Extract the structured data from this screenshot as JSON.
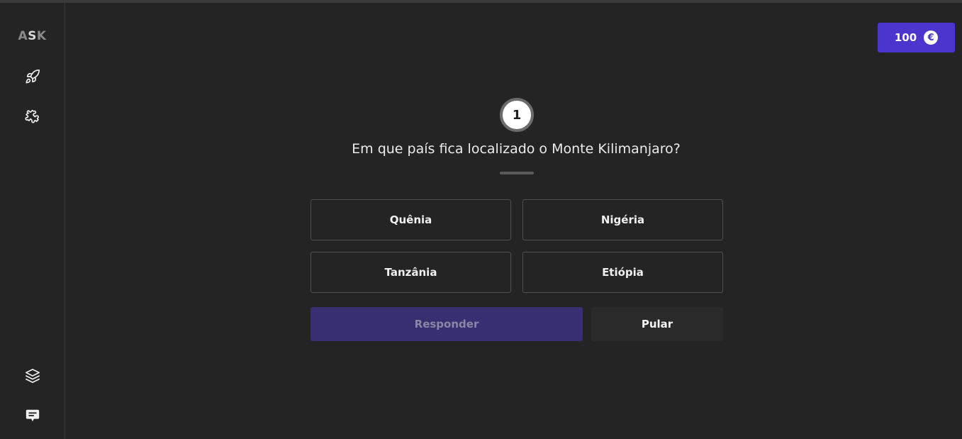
{
  "sidebar": {
    "logo": {
      "part1": "A",
      "part2": "S",
      "part3": "K"
    },
    "icons": [
      "rocket-icon",
      "puzzle-icon",
      "layers-icon",
      "chat-icon"
    ]
  },
  "wallet": {
    "amount": "100",
    "currency_symbol": "€"
  },
  "quiz": {
    "question_number": "1",
    "question": "Em que país fica localizado o Monte Kilimanjaro?",
    "answers": [
      "Quênia",
      "Nigéria",
      "Tanzânia",
      "Etiópia"
    ],
    "submit_label": "Responder",
    "skip_label": "Pular"
  },
  "colors": {
    "background": "#242424",
    "accent": "#4a35cf",
    "submit_disabled": "#372f71"
  }
}
